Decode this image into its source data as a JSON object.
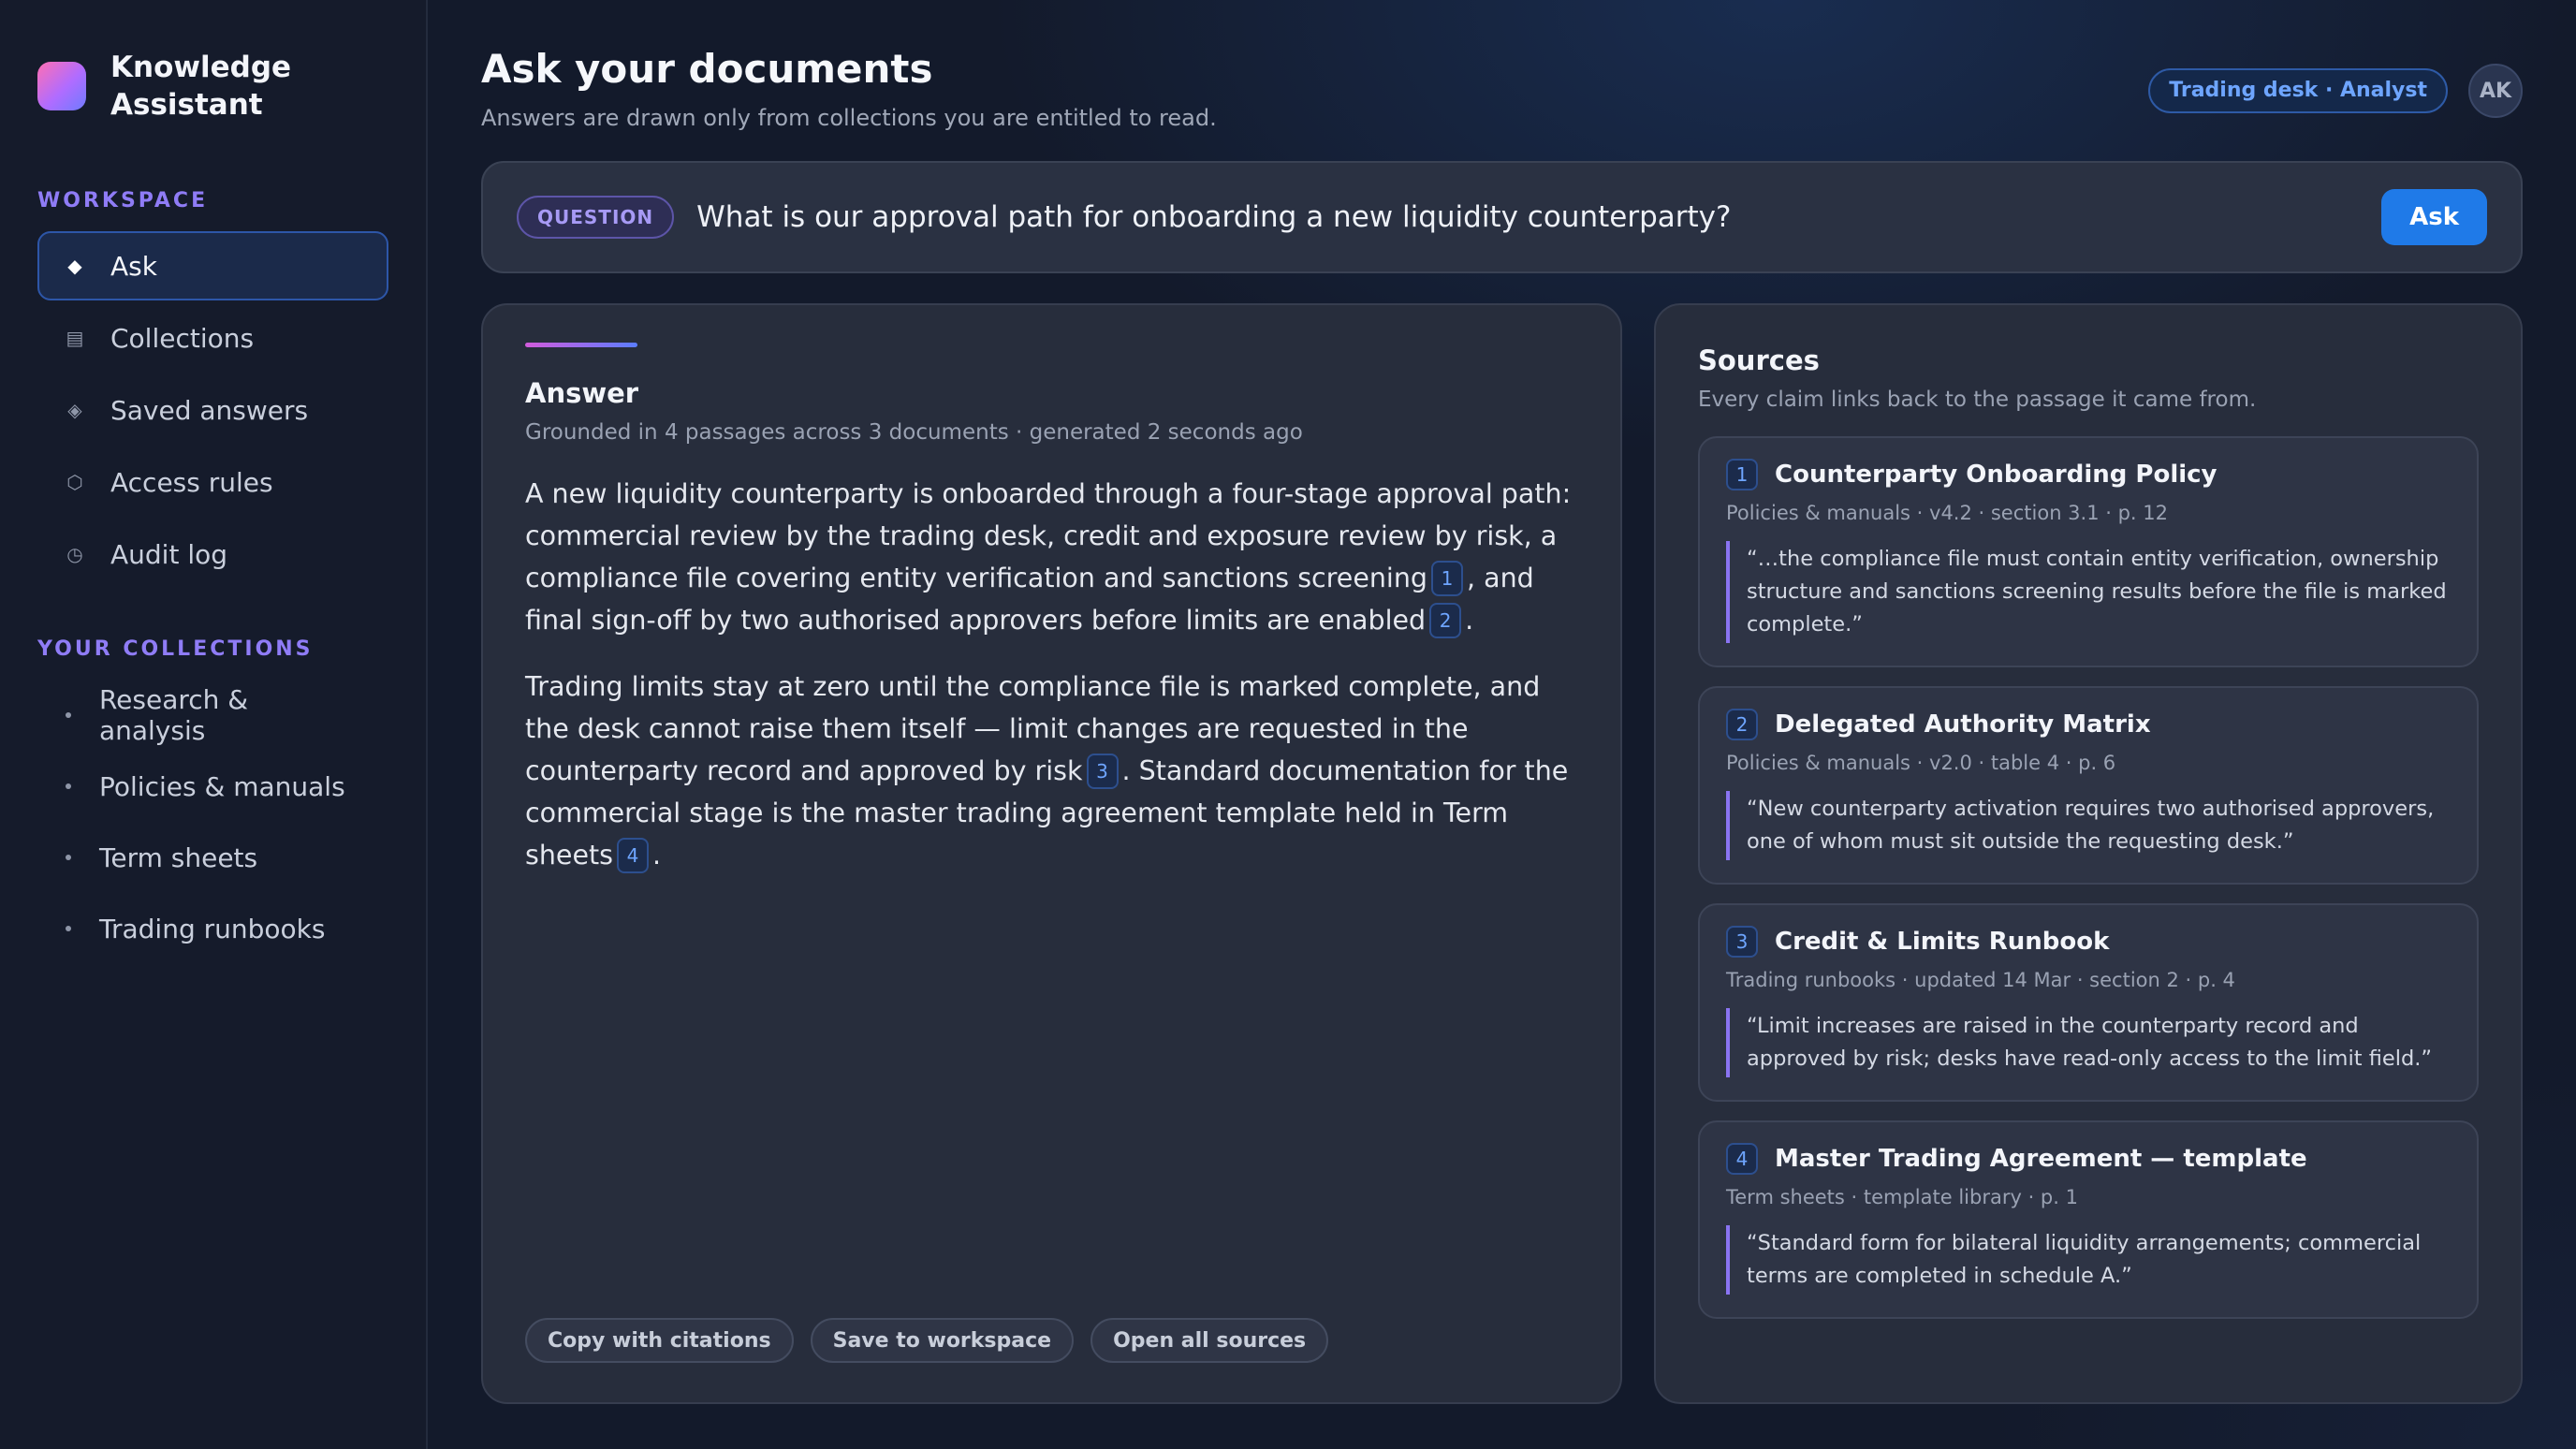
{
  "brand": {
    "name": "Knowledge Assistant"
  },
  "sidebar": {
    "workspace_label": "WORKSPACE",
    "items": [
      {
        "label": "Ask",
        "icon": "diamond-icon",
        "glyph": "◆"
      },
      {
        "label": "Collections",
        "icon": "list-icon",
        "glyph": "▤"
      },
      {
        "label": "Saved answers",
        "icon": "bookmark-diamond-icon",
        "glyph": "◈"
      },
      {
        "label": "Access rules",
        "icon": "hexagon-icon",
        "glyph": "⬡"
      },
      {
        "label": "Audit log",
        "icon": "clock-icon",
        "glyph": "◷"
      }
    ],
    "collections_label": "YOUR COLLECTIONS",
    "collections": [
      {
        "label": "Research & analysis"
      },
      {
        "label": "Policies & manuals"
      },
      {
        "label": "Term sheets"
      },
      {
        "label": "Trading runbooks"
      }
    ]
  },
  "header": {
    "title": "Ask your documents",
    "subtitle": "Answers are drawn only from collections you are entitled to read.",
    "role_badge": "Trading desk · Analyst",
    "avatar_initials": "AK"
  },
  "question": {
    "tag": "QUESTION",
    "text": "What is our approval path for onboarding a new liquidity counterparty?",
    "ask_label": "Ask"
  },
  "answer": {
    "title": "Answer",
    "meta": "Grounded in 4 passages across 3 documents · generated 2 seconds ago",
    "para1": {
      "part1": "A new liquidity counterparty is onboarded through a four-stage approval path: commercial review by the trading desk, credit and exposure review by risk, a compliance file covering entity verification and sanctions screening",
      "cite1": "1",
      "part2": ", and final sign-off by two authorised approvers before limits are enabled",
      "cite2": "2",
      "part3": "."
    },
    "para2": {
      "part1": "Trading limits stay at zero until the compliance file is marked complete, and the desk cannot raise them itself — limit changes are requested in the counterparty record and approved by risk",
      "cite1": "3",
      "part2": ". Standard documentation for the commercial stage is the master trading agreement template held in Term sheets",
      "cite2": "4",
      "part3": "."
    },
    "actions": {
      "copy": "Copy with citations",
      "save": "Save to workspace",
      "open": "Open all sources"
    }
  },
  "sources": {
    "title": "Sources",
    "subtitle": "Every claim links back to the passage it came from.",
    "items": [
      {
        "num": "1",
        "title": "Counterparty Onboarding Policy",
        "meta": "Policies & manuals · v4.2 · section 3.1 · p. 12",
        "quote": "“…the compliance file must contain entity verification, ownership structure and sanctions screening results before the file is marked complete.”"
      },
      {
        "num": "2",
        "title": "Delegated Authority Matrix",
        "meta": "Policies & manuals · v2.0 · table 4 · p. 6",
        "quote": "“New counterparty activation requires two authorised approvers, one of whom must sit outside the requesting desk.”"
      },
      {
        "num": "3",
        "title": "Credit & Limits Runbook",
        "meta": "Trading runbooks · updated 14 Mar · section 2 · p. 4",
        "quote": "“Limit increases are raised in the counterparty record and approved by risk; desks have read-only access to the limit field.”"
      },
      {
        "num": "4",
        "title": "Master Trading Agreement — template",
        "meta": "Term sheets · template library · p. 1",
        "quote": "“Standard form for bilateral liquidity arrangements; commercial terms are completed in schedule A.”"
      }
    ]
  },
  "colors": {
    "accent": "#1f7ae8",
    "brand_gradient_start": "#ff6fb3",
    "brand_gradient_end": "#6e7bff",
    "section_label": "#8f7cf6",
    "quote_border": "#8a74f2"
  }
}
